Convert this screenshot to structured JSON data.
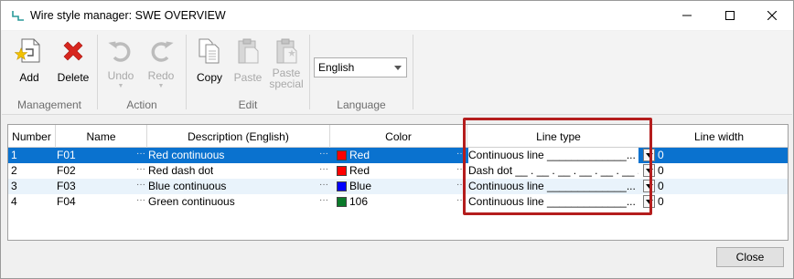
{
  "window": {
    "title": "Wire style manager: SWE OVERVIEW"
  },
  "ribbon": {
    "groups": {
      "management": "Management",
      "action": "Action",
      "edit": "Edit",
      "language": "Language"
    },
    "buttons": {
      "add": "Add",
      "delete": "Delete",
      "undo": "Undo",
      "redo": "Redo",
      "copy": "Copy",
      "paste": "Paste",
      "paste_special_1": "Paste",
      "paste_special_2": "special"
    },
    "language_value": "English"
  },
  "grid": {
    "headers": {
      "number": "Number",
      "name": "Name",
      "description": "Description (English)",
      "color": "Color",
      "line_type": "Line type",
      "line_width": "Line width"
    },
    "rows": [
      {
        "number": "1",
        "name": "F01",
        "description": "Red continuous",
        "color_name": "Red",
        "color_hex": "#ff0000",
        "line_type": "Continuous line _____________...",
        "tail": "0"
      },
      {
        "number": "2",
        "name": "F02",
        "description": "Red dash dot",
        "color_name": "Red",
        "color_hex": "#ff0000",
        "line_type": "Dash dot __ . __ . __ . __ . __ . __ . __",
        "tail": "0"
      },
      {
        "number": "3",
        "name": "F03",
        "description": "Blue continuous",
        "color_name": "Blue",
        "color_hex": "#0000ff",
        "line_type": "Continuous line _____________...",
        "tail": "0"
      },
      {
        "number": "4",
        "name": "F04",
        "description": "Green continuous",
        "color_name": "106",
        "color_hex": "#0a7a2a",
        "line_type": "Continuous line _____________...",
        "tail": "0"
      }
    ]
  },
  "footer": {
    "close_label": "Close"
  },
  "colors": {
    "selection": "#0a72cf",
    "highlight_box": "#b41d1d",
    "delete_icon": "#d7261e",
    "add_star": "#f2c200"
  }
}
